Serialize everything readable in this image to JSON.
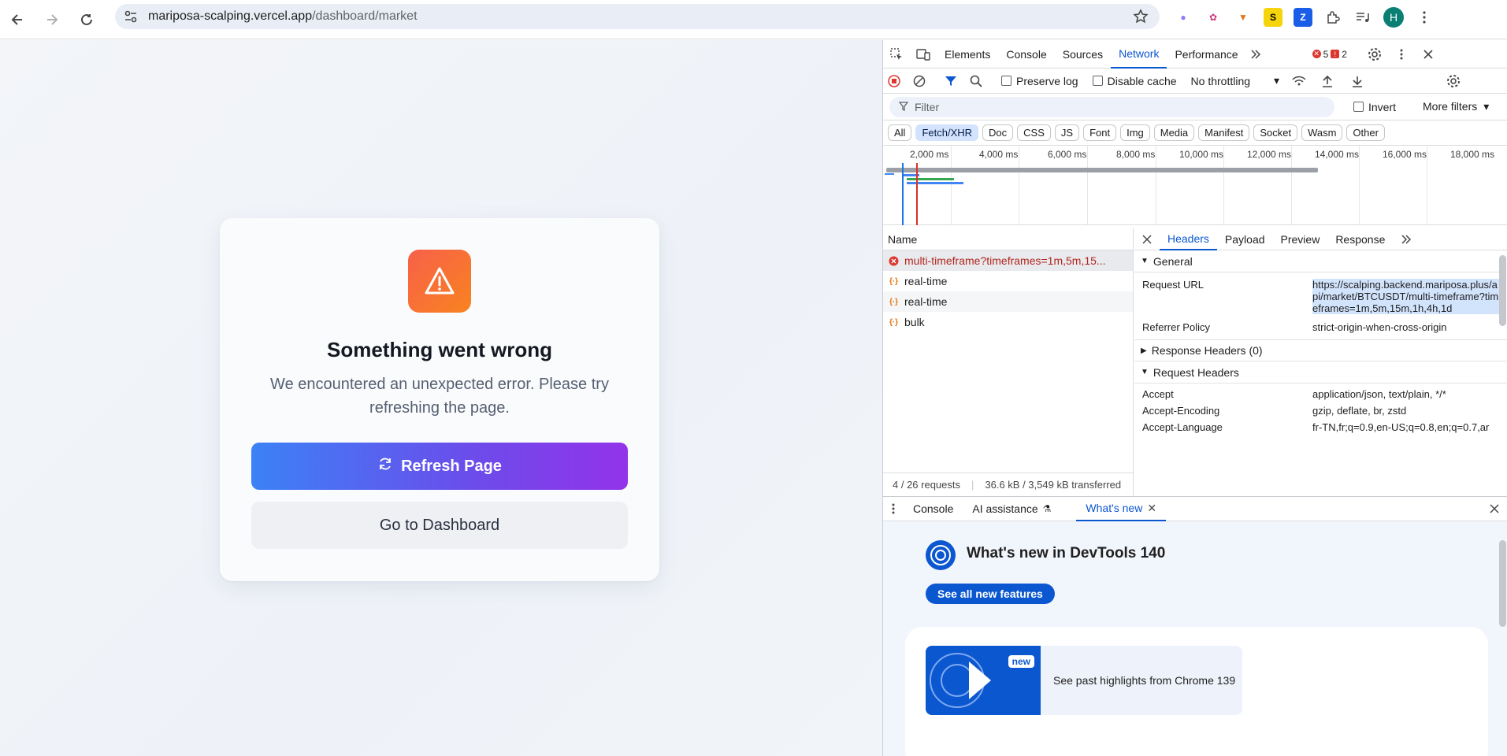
{
  "browser": {
    "url_host": "mariposa-scalping.vercel.app",
    "url_path": "/dashboard/market",
    "avatar_letter": "H"
  },
  "error_card": {
    "title": "Something went wrong",
    "message": "We encountered an unexpected error. Please try refreshing the page.",
    "refresh_label": "Refresh Page",
    "dashboard_label": "Go to Dashboard"
  },
  "devtools": {
    "tabs": [
      "Elements",
      "Console",
      "Sources",
      "Network",
      "Performance"
    ],
    "active_tab": "Network",
    "error_count": "5",
    "warning_count": "2",
    "toolbar": {
      "preserve_log": "Preserve log",
      "disable_cache": "Disable cache",
      "throttling": "No throttling"
    },
    "filter": {
      "placeholder": "Filter",
      "invert": "Invert",
      "more_filters": "More filters"
    },
    "type_filters": [
      "All",
      "Fetch/XHR",
      "Doc",
      "CSS",
      "JS",
      "Font",
      "Img",
      "Media",
      "Manifest",
      "Socket",
      "Wasm",
      "Other"
    ],
    "active_type": "Fetch/XHR",
    "timeline_ticks": [
      "2,000 ms",
      "4,000 ms",
      "6,000 ms",
      "8,000 ms",
      "10,000 ms",
      "12,000 ms",
      "14,000 ms",
      "16,000 ms",
      "18,000 ms"
    ],
    "name_header": "Name",
    "requests": [
      {
        "name": "multi-timeframe?timeframes=1m,5m,15...",
        "status": "error"
      },
      {
        "name": "real-time",
        "status": "ok"
      },
      {
        "name": "real-time",
        "status": "ok"
      },
      {
        "name": "bulk",
        "status": "ok"
      }
    ],
    "status_bar": {
      "requests": "4 / 26 requests",
      "transferred": "36.6 kB / 3,549 kB transferred"
    },
    "detail_tabs": [
      "Headers",
      "Payload",
      "Preview",
      "Response"
    ],
    "general": {
      "section": "General",
      "request_url_label": "Request URL",
      "request_url": "https://scalping.backend.mariposa.plus/api/market/BTCUSDT/multi-timeframe?timeframes=1m,5m,15m,1h,4h,1d",
      "referrer_label": "Referrer Policy",
      "referrer": "strict-origin-when-cross-origin"
    },
    "response_headers": "Response Headers (0)",
    "request_headers": {
      "section": "Request Headers",
      "accept_label": "Accept",
      "accept": "application/json, text/plain, */*",
      "encoding_label": "Accept-Encoding",
      "encoding": "gzip, deflate, br, zstd",
      "language_label": "Accept-Language",
      "language": "fr-TN,fr;q=0.9,en-US;q=0.8,en;q=0.7,ar"
    },
    "drawer_tabs": [
      "Console",
      "AI assistance",
      "What's new"
    ],
    "whats_new": {
      "title": "What's new in DevTools 140",
      "button": "See all new features",
      "new_badge": "new",
      "video_text": "See past highlights from Chrome 139"
    }
  }
}
